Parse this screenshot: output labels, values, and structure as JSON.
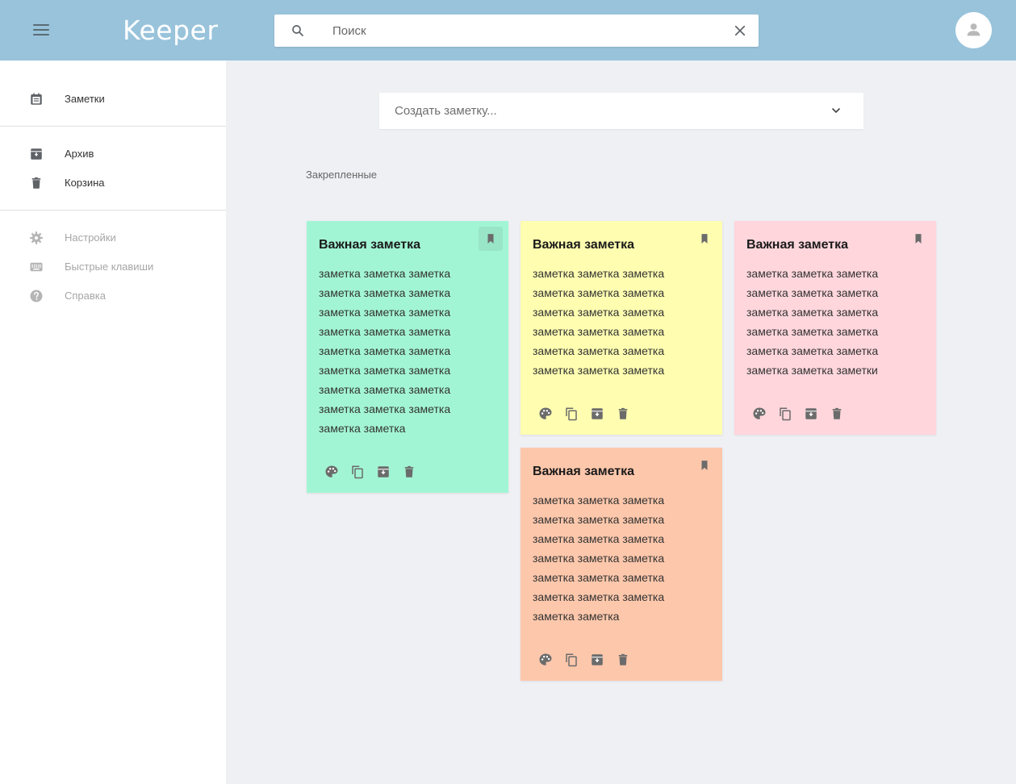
{
  "app": {
    "title": "Keeper"
  },
  "search": {
    "placeholder": "Поиск"
  },
  "sidebar": {
    "items": [
      {
        "label": "Заметки",
        "icon": "notes-icon"
      },
      {
        "label": "Архив",
        "icon": "archive-icon"
      },
      {
        "label": "Корзина",
        "icon": "trash-icon"
      },
      {
        "label": "Настройки",
        "icon": "gear-icon"
      },
      {
        "label": "Быстрые клавиши",
        "icon": "keyboard-icon"
      },
      {
        "label": "Справка",
        "icon": "help-icon"
      }
    ]
  },
  "create": {
    "placeholder": "Создать заметку..."
  },
  "section": {
    "pinned_label": "Закрепленные"
  },
  "notes": [
    {
      "title": "Важная заметка",
      "text": "заметка заметка заметка заметка заметка заметка заметка заметка заметка заметка заметка заметка заметка заметка заметка заметка заметка заметка заметка заметка заметка заметка заметка заметка заметка заметка",
      "color": "#a2f5d4",
      "pinned": true
    },
    {
      "title": "Важная заметка",
      "text": "заметка заметка заметка заметка заметка заметка заметка заметка заметка заметка заметка заметка заметка заметка заметка заметка заметка заметка",
      "color": "#fefdb0",
      "pinned": true
    },
    {
      "title": "Важная заметка",
      "text": "заметка заметка заметка заметка заметка заметка заметка заметка заметка заметка заметка заметка заметка заметка заметка заметка заметка заметки",
      "color": "#fed6dc",
      "pinned": true
    },
    {
      "title": "Важная заметка",
      "text": "заметка заметка заметка заметка заметка заметка заметка заметка заметка заметка заметка заметка заметка заметка заметка заметка заметка заметка заметка заметка",
      "color": "#fdc7ab",
      "pinned": true
    }
  ],
  "theme": {
    "header": "#98c3db",
    "background": "#eff0f4",
    "icon": "#6b6b6b"
  }
}
